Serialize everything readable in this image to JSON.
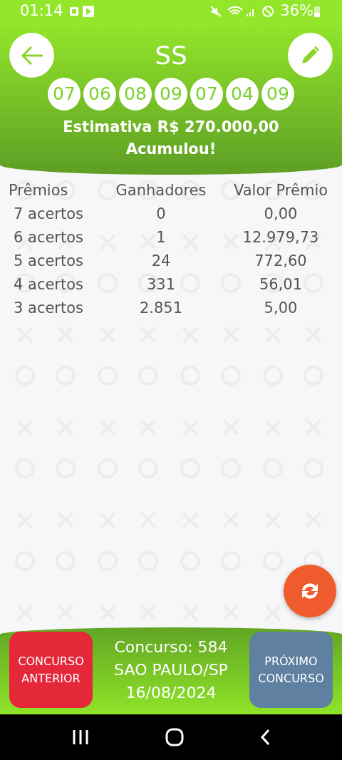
{
  "status_bar": {
    "time": "01:14",
    "battery": "36%"
  },
  "header": {
    "title": "SS",
    "numbers": [
      "07",
      "06",
      "08",
      "09",
      "07",
      "04",
      "09"
    ],
    "estimate": "Estimativa R$ 270.000,00",
    "result": "Acumulou!"
  },
  "table": {
    "columns": [
      "Prêmios",
      "Ganhadores",
      "Valor Prêmio"
    ],
    "rows": [
      [
        "7 acertos",
        "0",
        "0,00"
      ],
      [
        "6 acertos",
        "1",
        "12.979,73"
      ],
      [
        "5 acertos",
        "24",
        "772,60"
      ],
      [
        "4 acertos",
        "331",
        "56,01"
      ],
      [
        "3 acertos",
        "2.851",
        "5,00"
      ]
    ]
  },
  "footer": {
    "previous_button": "CONCURSO ANTERIOR",
    "info": [
      "Concurso: 584",
      "SAO PAULO/SP",
      "16/08/2024"
    ],
    "next_button": "PRÓXIMO CONCURSO"
  }
}
